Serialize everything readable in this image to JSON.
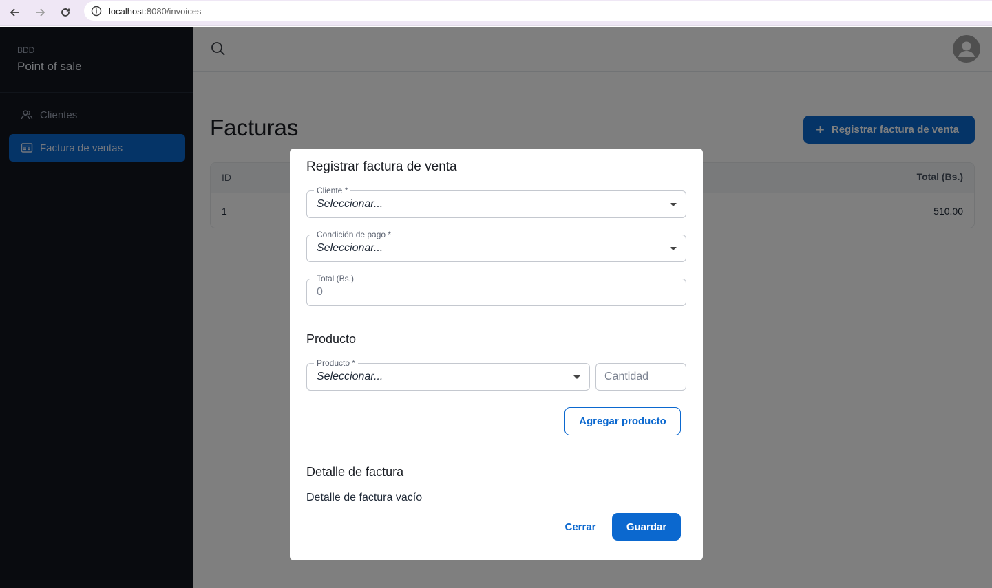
{
  "browser": {
    "url_host": "localhost",
    "url_rest": ":8080/invoices"
  },
  "brand": {
    "small": "BDD",
    "title": "Point of sale"
  },
  "sidebar": {
    "items": [
      {
        "label": "Clientes",
        "icon": "users-icon",
        "active": false
      },
      {
        "label": "Factura de ventas",
        "icon": "invoice-icon",
        "active": true
      }
    ]
  },
  "page": {
    "title": "Facturas",
    "primary_action": "Registrar factura de venta"
  },
  "table": {
    "headers": {
      "id": "ID",
      "total": "Total (Bs.)"
    },
    "rows": [
      {
        "id": "1",
        "total": "510.00"
      }
    ]
  },
  "modal": {
    "title": "Registrar factura de venta",
    "fields": {
      "cliente": {
        "label": "Cliente *",
        "value": "Seleccionar..."
      },
      "condicion": {
        "label": "Condición de pago *",
        "value": "Seleccionar..."
      },
      "total": {
        "label": "Total (Bs.)",
        "value": "0"
      }
    },
    "product_section": {
      "title": "Producto",
      "producto": {
        "label": "Producto *",
        "value": "Seleccionar..."
      },
      "cantidad_placeholder": "Cantidad",
      "add_button": "Agregar producto"
    },
    "detail_section": {
      "title": "Detalle de factura",
      "empty": "Detalle de factura vacío"
    },
    "actions": {
      "close": "Cerrar",
      "save": "Guardar"
    }
  },
  "colors": {
    "primary": "#0b68cf",
    "sidebar_bg": "#12161e",
    "overlay": "rgba(0,0,0,0.5)"
  }
}
